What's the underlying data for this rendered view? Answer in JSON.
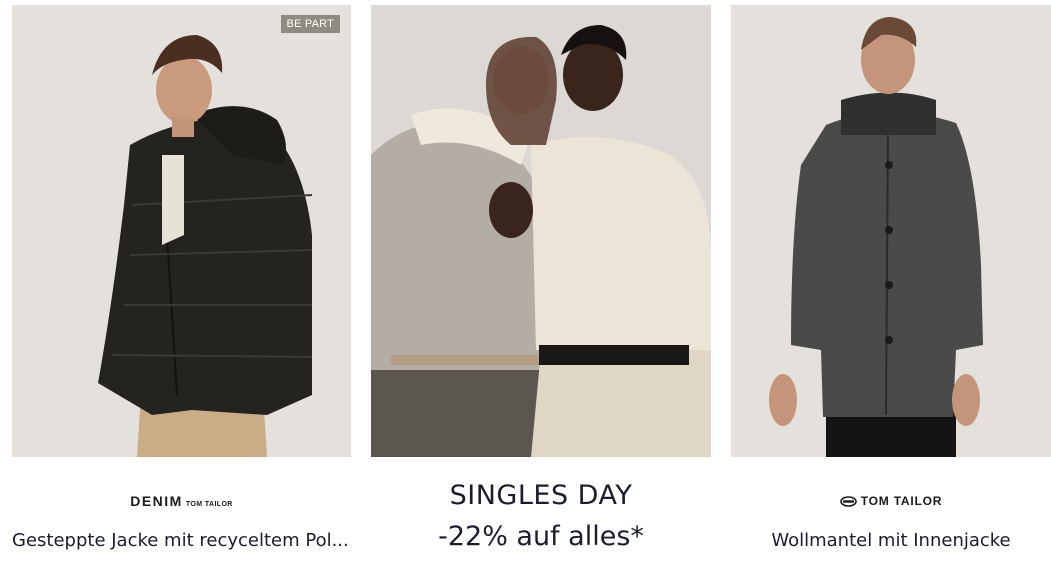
{
  "products": [
    {
      "badge": "BE PART",
      "brand_main": "DENIM",
      "brand_sub": "TOM TAILOR",
      "name": "Gesteppte Jacke mit recyceltem Pol..."
    },
    {
      "brand": "TOM TAILOR",
      "name": "Wollmantel mit Innenjacke"
    }
  ],
  "promo": {
    "title": "SINGLES DAY",
    "subtitle": "-22% auf alles*"
  },
  "colors": {
    "text": "#1a1d2e",
    "badge_bg": "#8e8c81",
    "photo_bg": "#e4e1dc"
  }
}
